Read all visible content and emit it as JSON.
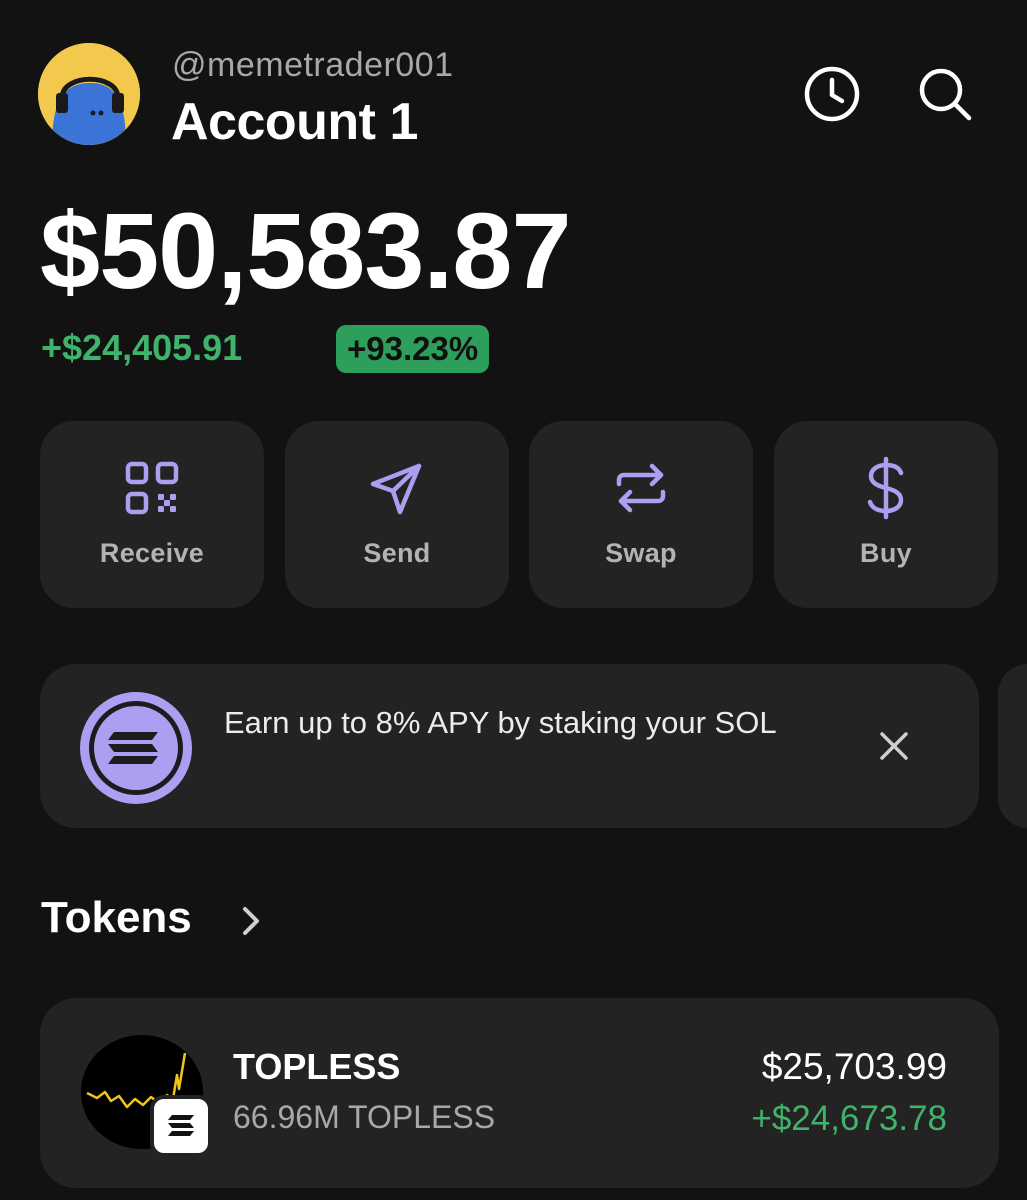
{
  "header": {
    "handle": "@memetrader001",
    "account_name": "Account 1",
    "icons": [
      "history-icon",
      "search-icon"
    ]
  },
  "balance": {
    "total": "$50,583.87",
    "change_amount": "+$24,405.91",
    "change_percent": "+93.23%"
  },
  "actions": [
    {
      "label": "Receive",
      "icon": "qr-code-icon"
    },
    {
      "label": "Send",
      "icon": "paper-plane-icon"
    },
    {
      "label": "Swap",
      "icon": "swap-arrows-icon"
    },
    {
      "label": "Buy",
      "icon": "dollar-icon"
    }
  ],
  "promo": {
    "text": "Earn up to 8% APY by staking your SOL",
    "icon": "solana-icon"
  },
  "tokens": {
    "section_label": "Tokens",
    "items": [
      {
        "name": "TOPLESS",
        "amount": "66.96M TOPLESS",
        "value": "$25,703.99",
        "change": "+$24,673.78"
      }
    ]
  },
  "colors": {
    "background": "#121212",
    "card": "#232323",
    "accent_purple": "#ab9ff2",
    "positive_green": "#3fb36b",
    "badge_green": "#2e9e5d",
    "avatar_yellow": "#f2c94c",
    "avatar_blue": "#3b74d6"
  }
}
